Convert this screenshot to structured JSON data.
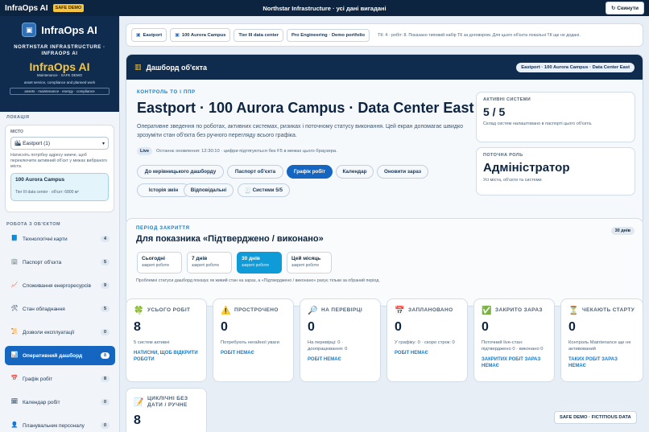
{
  "topbar": {
    "brand": "InfraOps AI",
    "safe_badge": "SAFE DEMO",
    "center_title": "Northstar Infrastructure · усі дані вигадані",
    "reset_button": "Скинути",
    "reset_icon": "refresh-icon"
  },
  "sidebar": {
    "logo_name": "InfraOps AI",
    "org_line1": "NORTHSTAR INFRASTRUCTURE ·",
    "org_line2": "INFRAOPS AI",
    "mark_title": "InfraOps AI",
    "mark_subtitle": "Maintenance · SAFE DEMO",
    "mark_desc": "asset service, compliance and planned work",
    "mark_tags": "assets · maintenance · energy · compliance",
    "location_section": "ЛОКАЦІЯ",
    "location_label": "МІСТО",
    "location_select": "Eastport (1)",
    "location_hint": "Натисніть потрібну адресу нижче, щоб переключити активний об'єкт у межах вибраного міста.",
    "current_site": "100 Aurora Campus",
    "current_site_meta": "Tier III data center · об'єкт: 6800 м²",
    "work_section": "РОБОТА З ОБ'ЄКТОМ",
    "nav": [
      {
        "label": "Технологічні карти",
        "count": "4",
        "icon": "📘"
      },
      {
        "label": "Паспорт об'єкта",
        "count": "5",
        "icon": "🏢"
      },
      {
        "label": "Споживання енергоресурсів",
        "count": "9",
        "icon": "📈"
      },
      {
        "label": "Стан обладнання",
        "count": "5",
        "icon": "🛠"
      },
      {
        "label": "Дозволи експлуатації",
        "count": "0",
        "icon": "📜"
      },
      {
        "label": "Оперативний дашборд",
        "count": "8",
        "icon": "📊"
      },
      {
        "label": "Графік робіт",
        "count": "8",
        "icon": "📅"
      },
      {
        "label": "Календар робіт",
        "count": "0",
        "icon": "🗓"
      },
      {
        "label": "Планувальник персоналу",
        "count": "0",
        "icon": "👤"
      }
    ]
  },
  "tabs": {
    "items": [
      "Eastport",
      "100 Aurora Campus",
      "Tier III data center",
      "Pro Engineering · Demo portfolio"
    ],
    "info": "ТК: 4 · робіт: 8. Показано типовий набір ТК за договором. Для цього об'єкта локальні ТК ще не додані."
  },
  "dashboard": {
    "header_title": "Дашборд об'єкта",
    "header_badge": "Eastport · 100 Aurora Campus · Data Center East",
    "kicker": "КОНТРОЛЬ ТО І ППР",
    "title": "Eastport · 100 Aurora Campus · Data Center East",
    "description": "Оперативне зведення по роботах, активних системах, ризиках і поточному статусу виконання. Цей екран допомагає швидко зрозуміти стан об'єкта без ручного перегляду всього графіка.",
    "live_badge": "Live",
    "last_update": "Останнє оновлення: 12:30:10 · цифри підтягуються без F5 в межах цього браузера.",
    "buttons": [
      "До керівницького дашборду",
      "Паспорт об'єкта",
      "Графік робіт",
      "Календар",
      "Оновити зараз",
      "Історія змін",
      "Відповідальні",
      "Системи 5/5"
    ],
    "systems_label": "АКТИВНІ СИСТЕМИ",
    "systems_value": "5 / 5",
    "systems_sub": "Склад систем налаштовано в паспорті цього об'єкта.",
    "role_label": "ПОТОЧНА РОЛЬ",
    "role_value": "Адміністратор",
    "role_sub": "Усі міста, об'єкти та системи"
  },
  "period": {
    "kicker": "ПЕРІОД ЗАКРИТТЯ",
    "title": "Для показника «Підтверджено / виконано»",
    "badge": "30 днів",
    "options": [
      {
        "label": "Сьогодні",
        "sub": "закриті роботи"
      },
      {
        "label": "7 днів",
        "sub": "закриті роботи"
      },
      {
        "label": "30 днів",
        "sub": "закриті роботи"
      },
      {
        "label": "Цей місяць",
        "sub": "закриті роботи"
      }
    ],
    "note": "Проблемні статуси дашборд показує як живий стан на зараз, а «Підтверджено / виконано» рахує тільки за обраний період."
  },
  "kpis": [
    {
      "title": "УСЬОГО РОБІТ",
      "value": "8",
      "sub": "5 систем активні",
      "link": "НАТИСНИ, ЩОБ ВІДКРИТИ РОБОТИ",
      "icon": "🍀"
    },
    {
      "title": "ПРОСТРОЧЕНО",
      "value": "0",
      "sub": "Потребують негайної уваги",
      "link": "РОБІТ НЕМАЄ",
      "icon": "⚠️"
    },
    {
      "title": "НА ПЕРЕВІРЦІ",
      "value": "0",
      "sub": "На перевірці: 0 · доопрацювання: 0",
      "link": "РОБІТ НЕМАЄ",
      "icon": "🔎"
    },
    {
      "title": "ЗАПЛАНОВАНО",
      "value": "0",
      "sub": "У графіку: 0 · скоро строк: 0",
      "link": "РОБІТ НЕМАЄ",
      "icon": "📅"
    },
    {
      "title": "ЗАКРИТО ЗАРАЗ",
      "value": "0",
      "sub": "Поточний live-стан: підтверджено 0 · виконано 0",
      "link": "ЗАКРИТИХ РОБІТ ЗАРАЗ НЕМАЄ",
      "icon": "✅"
    },
    {
      "title": "ЧЕКАЮТЬ СТАРТУ",
      "value": "0",
      "sub": "Контроль Maintenance ще не активований",
      "link": "ТАКИХ РОБІТ ЗАРАЗ НЕМАЄ",
      "icon": "⏳"
    },
    {
      "title": "ЦИКЛІЧНІ БЕЗ ДАТИ / РУЧНЕ",
      "value": "8",
      "sub": "",
      "link": "",
      "icon": "📝"
    }
  ],
  "footer_badge": "SAFE DEMO · FICTITIOUS DATA"
}
